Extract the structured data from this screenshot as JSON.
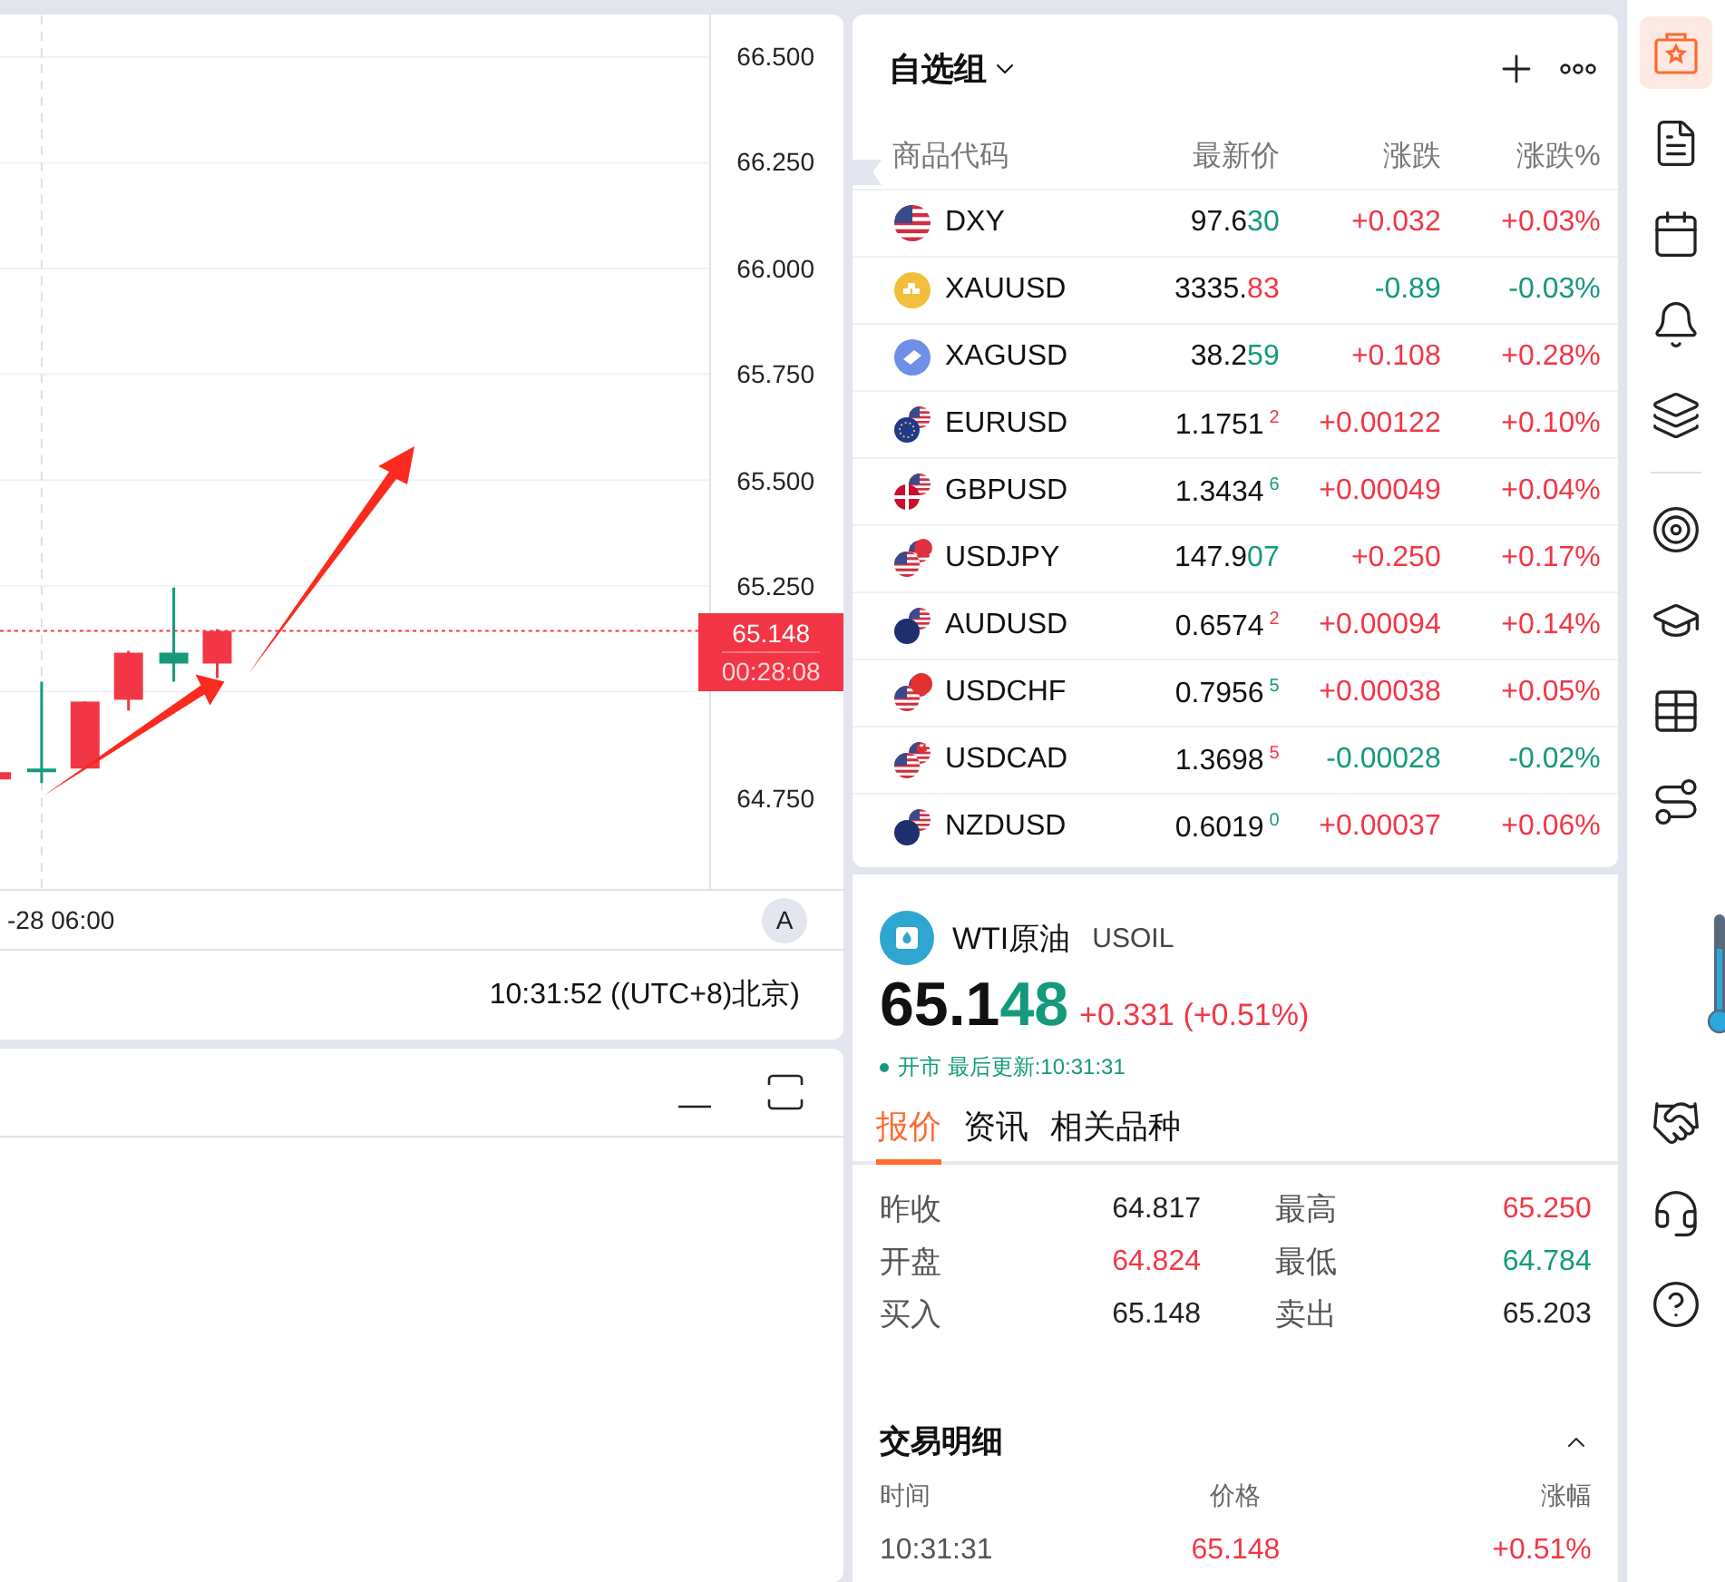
{
  "chart": {
    "price_axis": [
      "66.500",
      "66.250",
      "66.000",
      "65.750",
      "65.500",
      "65.250",
      "64.750"
    ],
    "current_price": {
      "price": "65.148",
      "countdown": "00:28:08"
    },
    "time_label": "-28 06:00",
    "auto_scale": "A",
    "clock": "10:31:52 ((UTC+8)北京)"
  },
  "watchlist": {
    "title": "自选组",
    "columns": [
      "商品代码",
      "最新价",
      "涨跌",
      "涨跌%"
    ],
    "rows": [
      {
        "kind": "us",
        "symbol": "DXY",
        "price": "97.6",
        "tail": "30",
        "tail_raised": false,
        "tail_rising": false,
        "change": "+0.032",
        "change_pct": "+0.03%",
        "rising": true
      },
      {
        "kind": "gold",
        "symbol": "XAUUSD",
        "price": "3335.",
        "tail": "83",
        "tail_raised": false,
        "tail_rising": true,
        "change": "-0.89",
        "change_pct": "-0.03%",
        "rising": false
      },
      {
        "kind": "silver",
        "symbol": "XAGUSD",
        "price": "38.2",
        "tail": "59",
        "tail_raised": false,
        "tail_rising": false,
        "change": "+0.108",
        "change_pct": "+0.28%",
        "rising": true
      },
      {
        "kind": "eur",
        "symbol": "EURUSD",
        "price": "1.1751",
        "tail": "2",
        "tail_raised": true,
        "tail_rising": true,
        "change": "+0.00122",
        "change_pct": "+0.10%",
        "rising": true
      },
      {
        "kind": "gbp",
        "symbol": "GBPUSD",
        "price": "1.3434",
        "tail": "6",
        "tail_raised": true,
        "tail_rising": false,
        "change": "+0.00049",
        "change_pct": "+0.04%",
        "rising": true
      },
      {
        "kind": "jpy",
        "symbol": "USDJPY",
        "price": "147.9",
        "tail": "07",
        "tail_raised": false,
        "tail_rising": false,
        "change": "+0.250",
        "change_pct": "+0.17%",
        "rising": true
      },
      {
        "kind": "aud",
        "symbol": "AUDUSD",
        "price": "0.6574",
        "tail": "2",
        "tail_raised": true,
        "tail_rising": true,
        "change": "+0.00094",
        "change_pct": "+0.14%",
        "rising": true
      },
      {
        "kind": "chf",
        "symbol": "USDCHF",
        "price": "0.7956",
        "tail": "5",
        "tail_raised": true,
        "tail_rising": false,
        "change": "+0.00038",
        "change_pct": "+0.05%",
        "rising": true
      },
      {
        "kind": "cad",
        "symbol": "USDCAD",
        "price": "1.3698",
        "tail": "5",
        "tail_raised": true,
        "tail_rising": true,
        "change": "-0.00028",
        "change_pct": "-0.02%",
        "rising": false
      },
      {
        "kind": "nzd",
        "symbol": "NZDUSD",
        "price": "0.6019",
        "tail": "0",
        "tail_raised": true,
        "tail_rising": false,
        "change": "+0.00037",
        "change_pct": "+0.06%",
        "rising": true
      }
    ]
  },
  "detail": {
    "name": "WTI原油",
    "symbol": "USOIL",
    "price": "65.1",
    "price_tail": "48",
    "price_tail_rising": false,
    "change": "+0.331 (+0.51%)",
    "rising": true,
    "market_open": true,
    "status": "开市 最后更新:10:31:31",
    "tabs": [
      {
        "label": "报价",
        "selected": true
      },
      {
        "label": "资讯",
        "selected": false
      },
      {
        "label": "相关品种",
        "selected": false
      }
    ],
    "stats": [
      {
        "label": "昨收",
        "value": "64.817",
        "color": "#222222"
      },
      {
        "label": "最高",
        "value": "65.250",
        "color": "#f23645"
      },
      {
        "label": "开盘",
        "value": "64.824",
        "color": "#f23645"
      },
      {
        "label": "最低",
        "value": "64.784",
        "color": "#13997c"
      },
      {
        "label": "买入",
        "value": "65.148",
        "color": "#222222"
      },
      {
        "label": "卖出",
        "value": "65.203",
        "color": "#222222"
      }
    ],
    "trades": {
      "title": "交易明细",
      "expanded": true,
      "columns": [
        "时间",
        "价格",
        "涨幅"
      ],
      "rows": [
        {
          "time": "10:31:31",
          "price": "65.148",
          "change": "+0.51%",
          "rising": true
        }
      ]
    }
  },
  "sidebar": {
    "items": [
      {
        "selected": true
      },
      {
        "selected": false
      },
      {
        "selected": false
      },
      {
        "selected": false
      },
      {
        "selected": false
      },
      {
        "selected": false
      },
      {
        "selected": false
      },
      {
        "selected": false
      },
      {
        "selected": false
      },
      {
        "selected": false
      },
      {
        "selected": false
      },
      {
        "selected": false
      }
    ]
  }
}
